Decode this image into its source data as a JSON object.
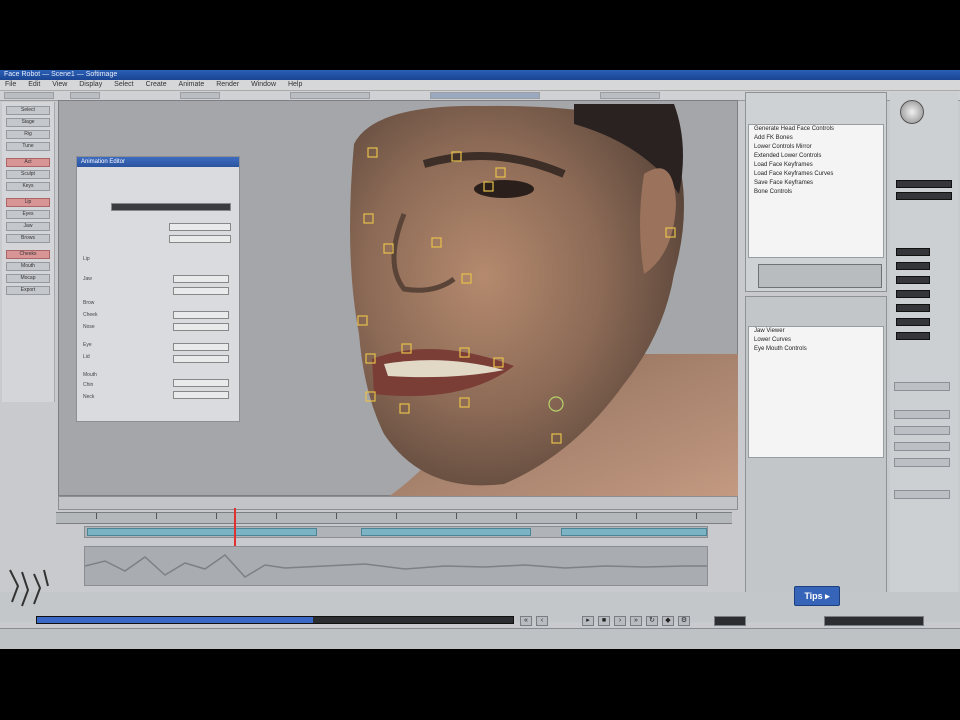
{
  "window": {
    "title": "Face Robot — Scene1 — Softimage",
    "menu": [
      "File",
      "Edit",
      "View",
      "Display",
      "Select",
      "Create",
      "Animate",
      "Render",
      "Window",
      "Help"
    ]
  },
  "left_panel": {
    "buttons": [
      {
        "label": "Select"
      },
      {
        "label": "Stage"
      },
      {
        "label": "Rig"
      },
      {
        "label": "Tune"
      },
      {
        "label": "Act"
      },
      {
        "label": "Sculpt"
      },
      {
        "label": "Keys"
      },
      {
        "label": "Lip"
      },
      {
        "label": "Eyes"
      },
      {
        "label": "Jaw"
      },
      {
        "label": "Brows"
      },
      {
        "label": "Cheeks"
      },
      {
        "label": "Mouth"
      },
      {
        "label": "Mocap"
      },
      {
        "label": "Export"
      }
    ]
  },
  "float_panel": {
    "title": "Animation Editor",
    "rows": [
      "Lip",
      "Jaw",
      "Brow",
      "Cheek",
      "Nose",
      "Eye",
      "Lid",
      "Mouth",
      "Chin",
      "Neck"
    ]
  },
  "right_panel": {
    "list_top": [
      "Generate Head Face Controls",
      "Add FK Bones",
      "Lower Controls Mirror",
      "Extended Lower Controls",
      "Load Face Keyframes",
      "Load Face Keyframes Curves",
      "Save Face Keyframes",
      "Bone Controls"
    ],
    "list_bottom": [
      "Jaw Viewer",
      "Lower Curves",
      "Eye Mouth Controls"
    ]
  },
  "transport": {
    "tips_label": "Tips ▸",
    "progress": 0.58
  },
  "colors": {
    "titlebar": "#2a5fb8",
    "clip": "#7bb3c4",
    "playhead": "#e03030",
    "tips": "#3564b8"
  }
}
